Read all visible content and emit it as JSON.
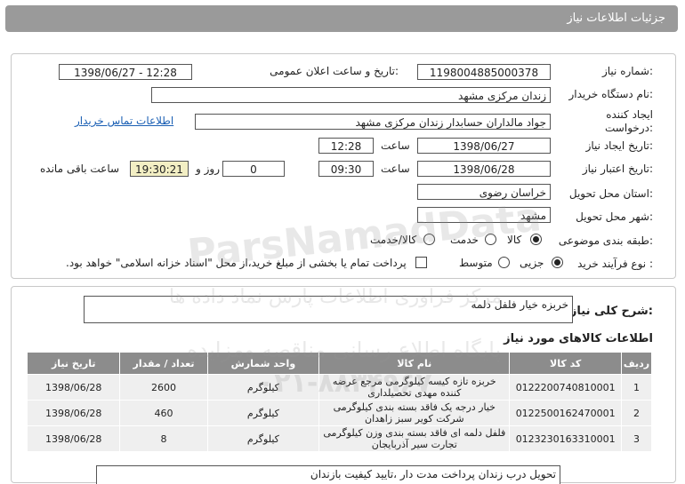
{
  "header": {
    "title": "جزئیات اطلاعات نیاز"
  },
  "form": {
    "need_number_label": "شماره نیاز:",
    "need_number": "1198004885000378",
    "announce_label": "تاریخ و ساعت اعلان عمومی:",
    "announce_value": "1398/06/27 - 12:28",
    "buyer_label": "نام دستگاه خریدار:",
    "buyer_value": "زندان مرکزی مشهد",
    "creator_label": "ایجاد کننده درخواست:",
    "creator_value": "جواد مالداران حسابدار زندان مرکزی مشهد",
    "contact_link": "اطلاعات تماس خریدار",
    "created_date_label": "تاریخ ایجاد نیاز:",
    "created_date": "1398/06/27",
    "created_time_label": "ساعت",
    "created_time": "12:28",
    "valid_date_label": "تاریخ اعتبار نیاز:",
    "valid_date": "1398/06/28",
    "valid_time_label": "ساعت",
    "valid_time": "09:30",
    "days_value": "0",
    "days_label": "روز و",
    "remaining_time": "19:30:21",
    "remaining_label": "ساعت باقی مانده",
    "province_label": "استان محل تحویل:",
    "province_value": "خراسان رضوی",
    "city_label": "شهر محل تحویل:",
    "city_value": "مشهد",
    "category_label": "طبقه بندی موضوعی:",
    "category_options": [
      "کالا",
      "خدمت",
      "کالا/خدمت"
    ],
    "category_selected": "کالا",
    "process_label": "نوع فرآیند خرید :",
    "process_options": [
      "جزیی",
      "متوسط"
    ],
    "process_selected": "جزیی",
    "payment_note": "پرداخت تمام یا بخشی از مبلغ خرید،از محل \"اسناد خزانه اسلامی\" خواهد بود."
  },
  "description": {
    "label": "شرح کلی نیاز:",
    "value": "خربزه خیار فلفل دلمه"
  },
  "items_section": {
    "title": "اطلاعات کالاهای مورد نیاز",
    "columns": [
      "ردیف",
      "کد کالا",
      "نام کالا",
      "واحد شمارش",
      "تعداد / مقدار",
      "تاریخ نیاز"
    ],
    "rows": [
      {
        "idx": "1",
        "code": "0122200740810001",
        "name": "خربزه تازه کیسه کیلوگرمی مرجع عرضه کننده مهدی تحصیلداری",
        "unit": "کیلوگرم",
        "qty": "2600",
        "date": "1398/06/28"
      },
      {
        "idx": "2",
        "code": "0122500162470001",
        "name": "خیار درجه یک فاقد بسته بندی کیلوگرمی شرکت کویر سبز زاهدان",
        "unit": "کیلوگرم",
        "qty": "460",
        "date": "1398/06/28"
      },
      {
        "idx": "3",
        "code": "0123230163310001",
        "name": "فلفل دلمه ای فاقد بسته بندی وزن کیلوگرمی تجارت سیر آذربایجان",
        "unit": "کیلوگرم",
        "qty": "8",
        "date": "1398/06/28"
      }
    ]
  },
  "notes": {
    "value": "تحویل درب زندان پرداخت مدت دار ،تایید کیفیت بازندان"
  },
  "watermark": {
    "text1": "ParsNamadData",
    "text2": "مرکز فراوری اطلاعات پارس نماد داده ها",
    "text3": "پایگاه اطلاع رسانی مناقصه ومزایده",
    "text4": "۰۲۱-۸۸۳۴۹۶۷۰"
  }
}
